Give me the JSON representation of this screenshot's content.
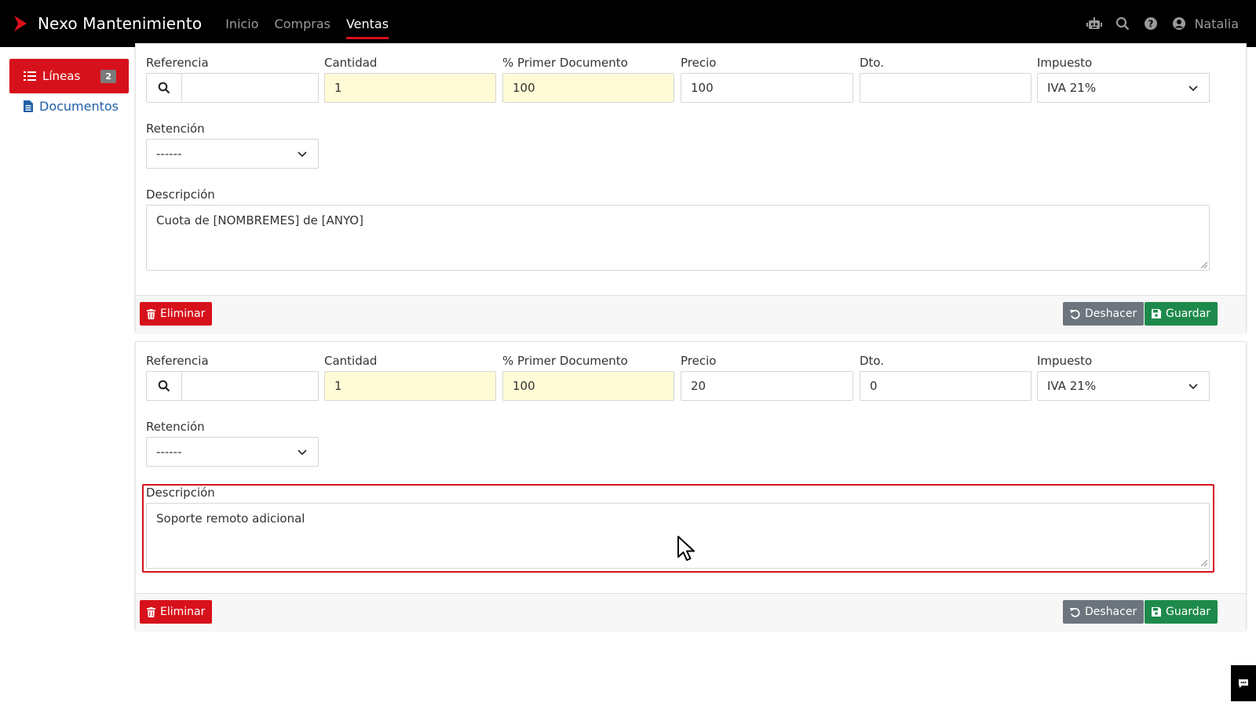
{
  "app": {
    "title": "Nexo Mantenimiento",
    "nav": [
      {
        "label": "Inicio"
      },
      {
        "label": "Compras"
      },
      {
        "label": "Ventas"
      }
    ],
    "user_name": "Natalia",
    "brand_color": "#d7111b"
  },
  "sidebar": {
    "lineas_label": "Líneas",
    "lineas_count": "2",
    "documentos_label": "Documentos"
  },
  "labels": {
    "referencia": "Referencia",
    "cantidad": "Cantidad",
    "primer_documento": "% Primer Documento",
    "precio": "Precio",
    "dto": "Dto.",
    "impuesto": "Impuesto",
    "retencion": "Retención",
    "descripcion": "Descripción",
    "eliminar": "Eliminar",
    "deshacer": "Deshacer",
    "guardar": "Guardar"
  },
  "lines": [
    {
      "referencia": "",
      "cantidad": "1",
      "primer_documento": "100",
      "precio": "100",
      "dto": "",
      "impuesto": "IVA 21%",
      "retencion": "------",
      "descripcion": "Cuota de [NOMBREMES] de [ANYO]"
    },
    {
      "referencia": "",
      "cantidad": "1",
      "primer_documento": "100",
      "precio": "20",
      "dto": "0",
      "impuesto": "IVA 21%",
      "retencion": "------",
      "descripcion": "Soporte remoto adicional"
    }
  ]
}
